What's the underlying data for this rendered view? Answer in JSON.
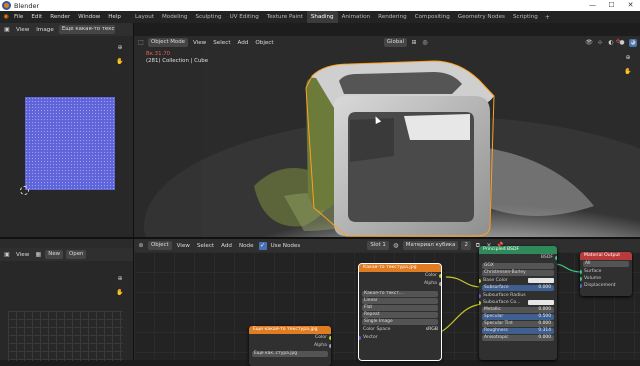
{
  "titlebar": {
    "title": "Blender",
    "controls": [
      "—",
      "☐",
      "✕"
    ]
  },
  "menu": [
    "File",
    "Edit",
    "Render",
    "Window",
    "Help"
  ],
  "workspaces": {
    "tabs": [
      "Layout",
      "Modeling",
      "Sculpting",
      "UV Editing",
      "Texture Paint",
      "Shading",
      "Animation",
      "Rendering",
      "Compositing",
      "Geometry Nodes",
      "Scripting"
    ],
    "active": "Shading",
    "add": "+"
  },
  "image_editor": {
    "view": "View",
    "image": "Image",
    "image_name": "Еще какая-то текст",
    "icons": [
      "editor-type-icon",
      "zoom-icon",
      "hand-icon",
      "cursor-icon"
    ]
  },
  "viewport": {
    "mode": "Object Mode",
    "menu": [
      "View",
      "Select",
      "Add",
      "Object"
    ],
    "transform": "Global",
    "overlay_title": "Вк.31.70",
    "overlay_sub": "(281) Collection | Cube"
  },
  "node_header": {
    "type": "Object",
    "menu": [
      "View",
      "Select",
      "Add",
      "Node"
    ],
    "use_nodes": "Use Nodes",
    "slot": "Slot 1",
    "material": "Материал кубика",
    "users": "2"
  },
  "left_bottom": {
    "view": "View",
    "new": "New",
    "open": "Open"
  },
  "nodes": {
    "image1": {
      "title": "Какая-то текстура.jpg",
      "outputs": [
        "Color",
        "Alpha"
      ],
      "image": "Какая-то текст...",
      "fields": [
        "Linear",
        "Flat",
        "Repeat",
        "Single Image"
      ],
      "colorspace_label": "Color Space",
      "colorspace": "sRGB",
      "vector": "Vector"
    },
    "image2": {
      "title": "Еще какая-то текстура.jpg",
      "outputs": [
        "Color",
        "Alpha"
      ],
      "image": "Еще как..стура.jpg"
    },
    "bsdf": {
      "title": "Principled BSDF",
      "output": "BSDF",
      "fields": [
        "GGX",
        "Christensen-Burley"
      ],
      "rows": [
        {
          "label": "Base Color",
          "value": ""
        },
        {
          "label": "Subsurface",
          "value": "0.000"
        },
        {
          "label": "Subsurface Radius",
          "value": ""
        },
        {
          "label": "Subsurface Co...",
          "value": ""
        },
        {
          "label": "Metallic",
          "value": "0.000"
        },
        {
          "label": "Specular",
          "value": "0.500"
        },
        {
          "label": "Specular Tint",
          "value": "0.000"
        },
        {
          "label": "Roughness",
          "value": "0.314"
        },
        {
          "label": "Anisotropic",
          "value": "0.000"
        }
      ]
    },
    "output": {
      "title": "Material Output",
      "target": "All",
      "inputs": [
        "Surface",
        "Volume",
        "Displacement"
      ]
    }
  },
  "colors": {
    "accent": "#4772b3",
    "image_node": "#e07d22",
    "shader_node": "#2e8a5a",
    "output_node": "#b83a3a",
    "selection": "#ffa020"
  }
}
